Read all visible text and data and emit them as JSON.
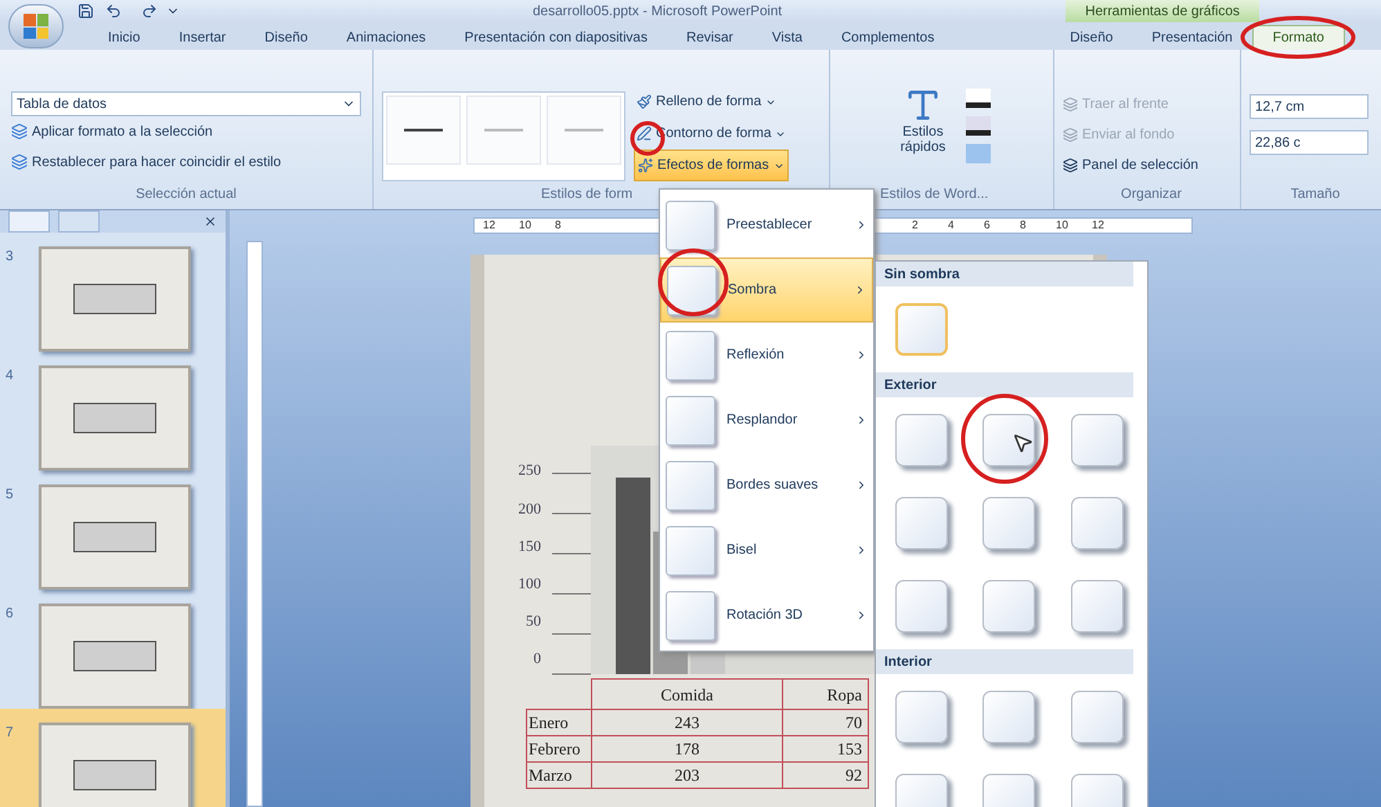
{
  "window": {
    "title": "desarrollo05.pptx - Microsoft PowerPoint",
    "contextual_title": "Herramientas de gráficos"
  },
  "tabs": [
    {
      "label": "Inicio",
      "selected": false
    },
    {
      "label": "Insertar",
      "selected": false
    },
    {
      "label": "Diseño",
      "selected": false
    },
    {
      "label": "Animaciones",
      "selected": false
    },
    {
      "label": "Presentación con diapositivas",
      "selected": false
    },
    {
      "label": "Revisar",
      "selected": false
    },
    {
      "label": "Vista",
      "selected": false
    },
    {
      "label": "Complementos",
      "selected": false
    },
    {
      "label": "Diseño",
      "selected": false
    },
    {
      "label": "Presentación",
      "selected": false
    },
    {
      "label": "Formato",
      "selected": true
    }
  ],
  "ribbon": {
    "seleccion": {
      "dropdown": "Tabla de datos",
      "commands": [
        "Aplicar formato a la selección",
        "Restablecer para hacer coincidir el estilo"
      ],
      "label": "Selección actual"
    },
    "estilos_forma": {
      "commands": [
        {
          "label": "Relleno de forma",
          "pressed": false
        },
        {
          "label": "Contorno de forma",
          "pressed": false
        },
        {
          "label": "Efectos de formas",
          "pressed": true
        }
      ],
      "label": "Estilos de form"
    },
    "wordart": {
      "button": "Estilos rápidos",
      "label": "Estilos de Word..."
    },
    "organizar": {
      "commands": [
        {
          "label": "Traer al frente",
          "disabled": true
        },
        {
          "label": "Enviar al fondo",
          "disabled": true
        },
        {
          "label": "Panel de selección",
          "disabled": false
        }
      ],
      "label": "Organizar"
    },
    "tamano": {
      "height": "12,7 cm",
      "width": "22,86 c",
      "label": "Tamaño"
    }
  },
  "slides_pane": {
    "slides": [
      {
        "number": "3",
        "selected": false
      },
      {
        "number": "4",
        "selected": false
      },
      {
        "number": "5",
        "selected": false
      },
      {
        "number": "6",
        "selected": false
      },
      {
        "number": "7",
        "selected": true
      }
    ]
  },
  "ruler": {
    "left_labels": [
      "12",
      "10",
      "8"
    ],
    "right_labels": [
      "2",
      "4",
      "6",
      "8",
      "10",
      "12"
    ]
  },
  "slide": {
    "chart": {
      "y_labels": [
        "250",
        "200",
        "150",
        "100",
        "50",
        "0"
      ]
    },
    "table": {
      "columns": [
        "Comida",
        "Ropa"
      ],
      "rows": [
        {
          "label": "Enero",
          "cells": [
            "243",
            "70"
          ]
        },
        {
          "label": "Febrero",
          "cells": [
            "178",
            "153"
          ]
        },
        {
          "label": "Marzo",
          "cells": [
            "203",
            "92"
          ]
        }
      ]
    }
  },
  "effects_menu": {
    "items": [
      {
        "label": "Preestablecer",
        "selected": false
      },
      {
        "label": "Sombra",
        "selected": true
      },
      {
        "label": "Reflexión",
        "selected": false
      },
      {
        "label": "Resplandor",
        "selected": false
      },
      {
        "label": "Bordes suaves",
        "selected": false
      },
      {
        "label": "Bisel",
        "selected": false
      },
      {
        "label": "Rotación 3D",
        "selected": false
      }
    ]
  },
  "shadow_submenu": {
    "sections": [
      {
        "title": "Sin sombra",
        "tiles": [
          {
            "selected": true,
            "hovered": false
          }
        ]
      },
      {
        "title": "Exterior",
        "tiles": [
          {
            "selected": false,
            "hovered": false
          },
          {
            "selected": false,
            "hovered": true
          },
          {
            "selected": false,
            "hovered": false
          },
          {
            "selected": false,
            "hovered": false
          },
          {
            "selected": false,
            "hovered": false
          },
          {
            "selected": false,
            "hovered": false
          },
          {
            "selected": false,
            "hovered": false
          },
          {
            "selected": false,
            "hovered": false
          },
          {
            "selected": false,
            "hovered": false
          }
        ]
      },
      {
        "title": "Interior",
        "tiles": [
          {
            "selected": false,
            "hovered": false
          },
          {
            "selected": false,
            "hovered": false
          },
          {
            "selected": false,
            "hovered": false
          },
          {
            "selected": false,
            "hovered": false
          },
          {
            "selected": false,
            "hovered": false
          },
          {
            "selected": false,
            "hovered": false
          }
        ]
      }
    ]
  }
}
